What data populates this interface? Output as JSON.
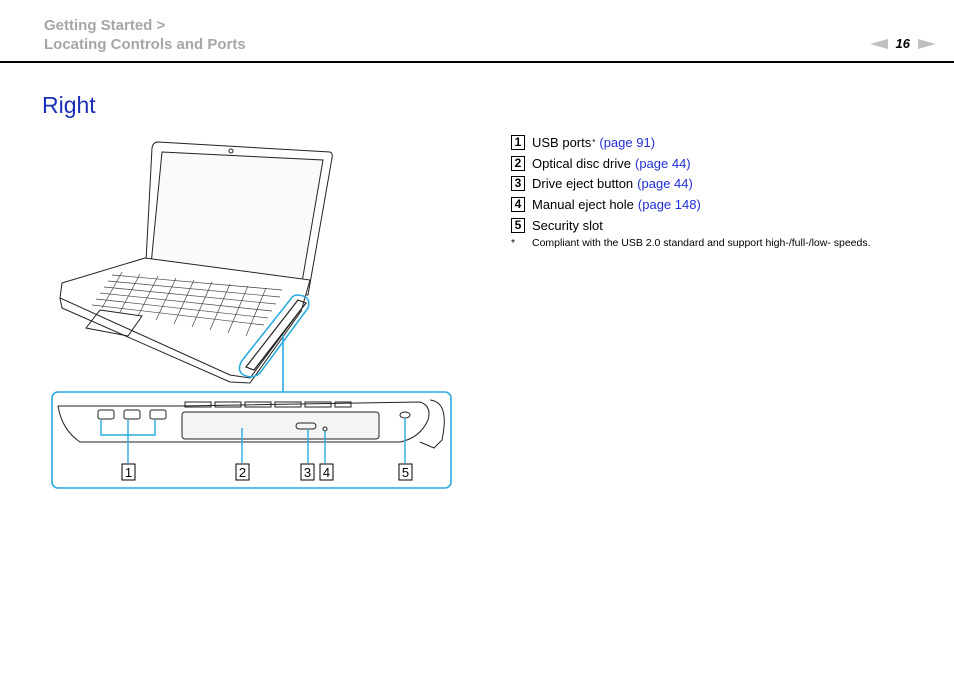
{
  "header": {
    "breadcrumb_line1": "Getting Started >",
    "breadcrumb_line2": "Locating Controls and Ports",
    "page_number": "16",
    "prev_icon": "triangle-left-icon",
    "next_icon": "triangle-right-icon"
  },
  "section": {
    "title": "Right"
  },
  "figure": {
    "callouts": [
      "1",
      "2",
      "3",
      "4",
      "5"
    ],
    "highlight_color": "#29aae1"
  },
  "legend": {
    "items": [
      {
        "num": "1",
        "label": "USB ports",
        "sup": "*",
        "link": "(page 91)"
      },
      {
        "num": "2",
        "label": "Optical disc drive",
        "link": "(page 44)"
      },
      {
        "num": "3",
        "label": "Drive eject button",
        "link": "(page 44)"
      },
      {
        "num": "4",
        "label": "Manual eject hole",
        "link": "(page 148)"
      },
      {
        "num": "5",
        "label": "Security slot"
      }
    ],
    "footnote_mark": "*",
    "footnote_text": "Compliant with the USB 2.0 standard and support high-/full-/low- speeds."
  },
  "colors": {
    "title": "#1b2eb8",
    "link": "#1f2fd6",
    "breadcrumb": "#a6a6a6",
    "callout": "#29aae1"
  }
}
